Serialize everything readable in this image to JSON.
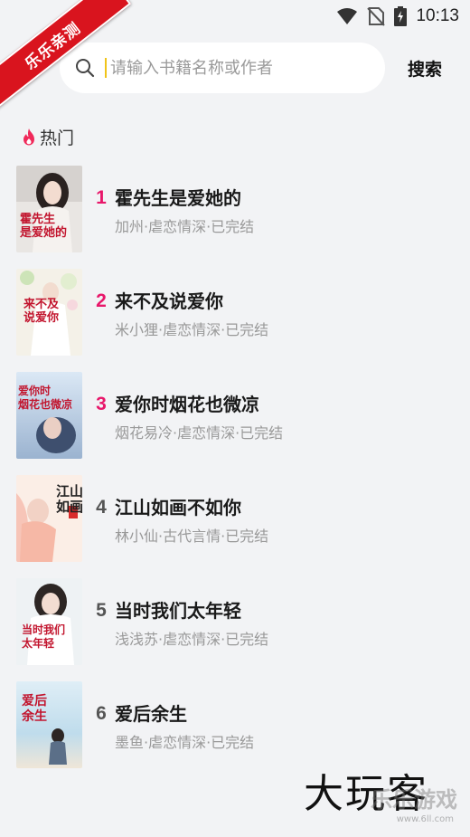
{
  "status_bar": {
    "time": "10:13"
  },
  "ribbon": {
    "text": "乐乐亲测"
  },
  "search": {
    "placeholder": "请输入书籍名称或作者",
    "value": "",
    "button_label": "搜索"
  },
  "hot": {
    "title": "热门",
    "books": [
      {
        "rank": "1",
        "title": "霍先生是爱她的",
        "meta": "加州·虐恋情深·已完结",
        "cover_text": "霍先生\n是爱她的"
      },
      {
        "rank": "2",
        "title": "来不及说爱你",
        "meta": "米小狸·虐恋情深·已完结",
        "cover_text": "来不及\n说爱你"
      },
      {
        "rank": "3",
        "title": "爱你时烟花也微凉",
        "meta": "烟花易冷·虐恋情深·已完结",
        "cover_text": "爱你时\n烟花也微凉"
      },
      {
        "rank": "4",
        "title": "江山如画不如你",
        "meta": "林小仙·古代言情·已完结",
        "cover_text": "江山\n如画"
      },
      {
        "rank": "5",
        "title": "当时我们太年轻",
        "meta": "浅浅苏·虐恋情深·已完结",
        "cover_text": "当时我们\n太年轻"
      },
      {
        "rank": "6",
        "title": "爱后余生",
        "meta": "墨鱼·虐恋情深·已完结",
        "cover_text": "爱后\n余生"
      }
    ]
  },
  "watermark": {
    "main": "大玩客",
    "sub": "乐乐游戏",
    "url": "www.6ll.com"
  },
  "colors": {
    "accent": "#e8176a",
    "background": "#f2f3f5",
    "ribbon": "#d9141e"
  }
}
